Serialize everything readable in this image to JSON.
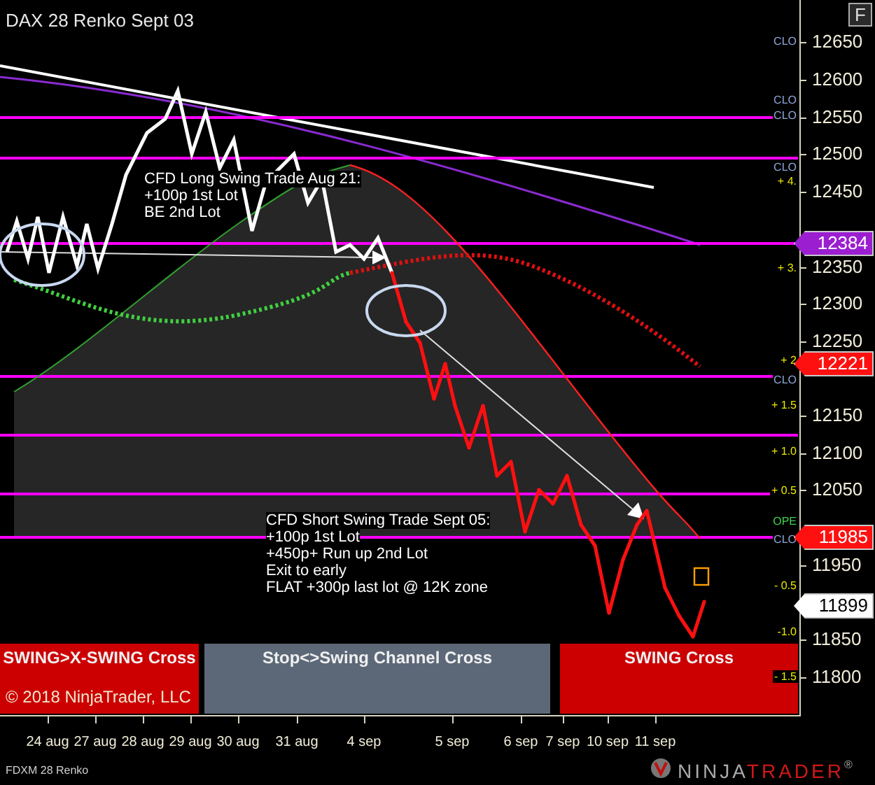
{
  "chart_title": "DAX 28 Renko Sept 03",
  "f_button": "F",
  "annotations": [
    {
      "lines": [
        "CFD Long Swing Trade Aug 21:",
        "+100p 1st Lot",
        "BE  2nd Lot"
      ]
    },
    {
      "lines": [
        "CFD Short Swing Trade Sept 05:",
        "+100p 1st Lot",
        "+450p+ Run up 2nd Lot",
        "Exit to early",
        "FLAT +300p last lot @ 12K zone"
      ]
    }
  ],
  "level_labels": [
    {
      "text": "CLO",
      "kind": "close"
    },
    {
      "text": "CLO",
      "kind": "close"
    },
    {
      "text": "CLO",
      "kind": "close"
    },
    {
      "text": "CLO",
      "kind": "close"
    },
    {
      "text": "+ 4.",
      "kind": "level"
    },
    {
      "text": "+ 3.",
      "kind": "level"
    },
    {
      "text": "+ 2",
      "kind": "level"
    },
    {
      "text": "CLO",
      "kind": "close"
    },
    {
      "text": "+ 1.5",
      "kind": "level"
    },
    {
      "text": "+ 1.0",
      "kind": "level"
    },
    {
      "text": "+ 0.5",
      "kind": "level"
    },
    {
      "text": "OPE",
      "kind": "open"
    },
    {
      "text": "CLO",
      "kind": "close"
    },
    {
      "text": "- 0.5",
      "kind": "level"
    },
    {
      "text": "-1.0",
      "kind": "level"
    },
    {
      "text": "- 1.5",
      "kind": "level"
    }
  ],
  "price_axis": [
    "12650",
    "12600",
    "12550",
    "12500",
    "12450",
    "12350",
    "12300",
    "12250",
    "12150",
    "12100",
    "12050",
    "11950",
    "11850",
    "11800"
  ],
  "price_badges": [
    {
      "text": "12384",
      "color": "#9b1fd0"
    },
    {
      "text": "12221",
      "color": "#ff1010"
    },
    {
      "text": "11985",
      "color": "#ff1010"
    },
    {
      "text": "11899",
      "color": "#ffffff"
    }
  ],
  "signal_bars": [
    {
      "text": "SWING>X-SWING Cross",
      "color": "#cc0000"
    },
    {
      "text": "Stop<>Swing  Channel Cross",
      "color": "#5c6878"
    },
    {
      "text": "SWING Cross",
      "color": "#cc0000"
    }
  ],
  "copyright": "© 2018 NinjaTrader, LLC",
  "date_axis": [
    "24 aug",
    "27 aug",
    "28 aug",
    "29 aug",
    "30 aug",
    "31 aug",
    "4 sep",
    "5 sep",
    "6 sep",
    "7 sep",
    "10 sep",
    "11 sep"
  ],
  "instrument": "FDXM 28 Renko",
  "logo": {
    "part_1": "NINJA",
    "part_2": "TRADER",
    "mark": "®"
  }
}
